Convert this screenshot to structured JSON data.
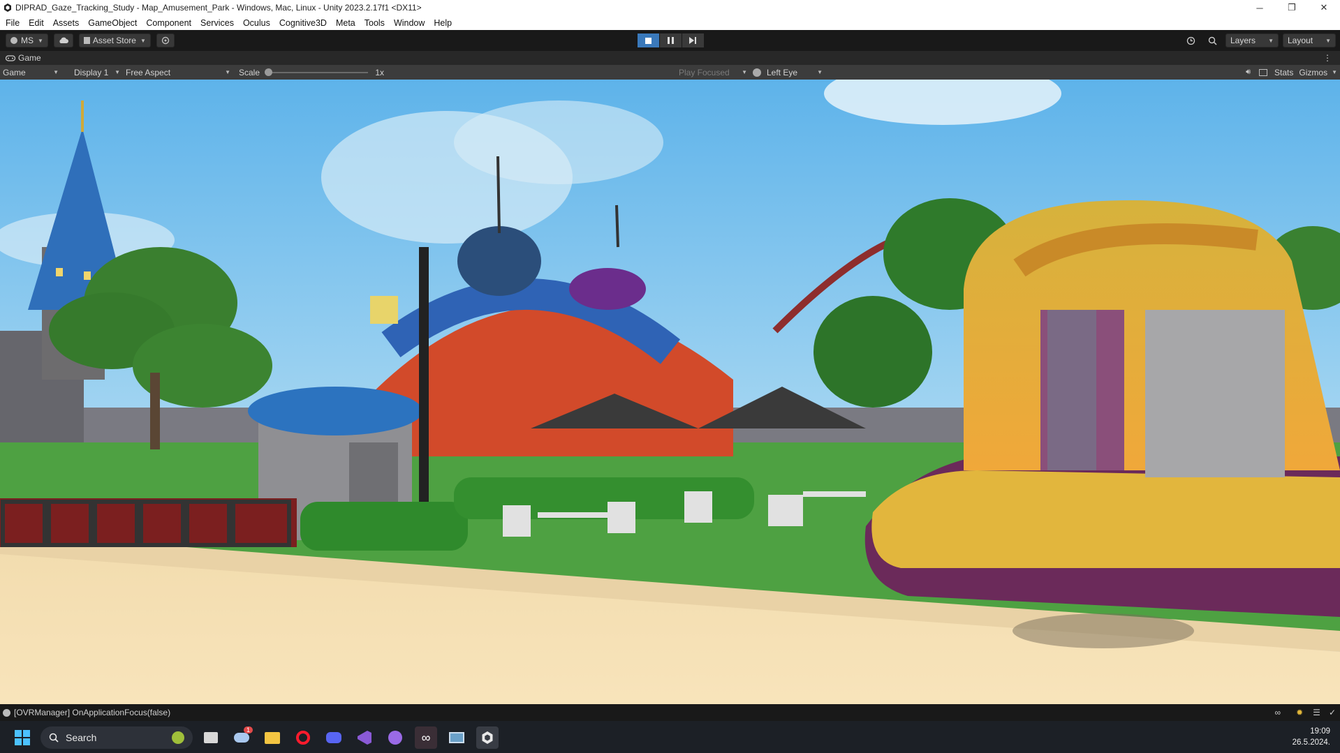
{
  "window": {
    "title": "DIPRAD_Gaze_Tracking_Study - Map_Amusement_Park - Windows, Mac, Linux - Unity 2023.2.17f1 <DX11>",
    "minimize": "─",
    "restore": "❐",
    "close": "✕"
  },
  "menu": [
    "File",
    "Edit",
    "Assets",
    "GameObject",
    "Component",
    "Services",
    "Oculus",
    "Cognitive3D",
    "Meta",
    "Tools",
    "Window",
    "Help"
  ],
  "toolbar": {
    "account": "MS",
    "asset_store": "Asset Store",
    "layers": "Layers",
    "layout": "Layout"
  },
  "tab": {
    "label": "Game"
  },
  "game_bar": {
    "mode": "Game",
    "display": "Display 1",
    "aspect": "Free Aspect",
    "scale_label": "Scale",
    "scale_value": "1x",
    "play_mode": "Play Focused",
    "eye": "Left Eye",
    "stats": "Stats",
    "gizmos": "Gizmos"
  },
  "status": {
    "message": "[OVRManager] OnApplicationFocus(false)"
  },
  "taskbar": {
    "search": "Search",
    "weather_badge": "1",
    "time": "19:09",
    "date": "26.5.2024."
  },
  "colors": {
    "play_active": "#3a79bb",
    "sky": "#8ec9ee",
    "grass": "#4fa043",
    "sand": "#f4dfb4"
  }
}
